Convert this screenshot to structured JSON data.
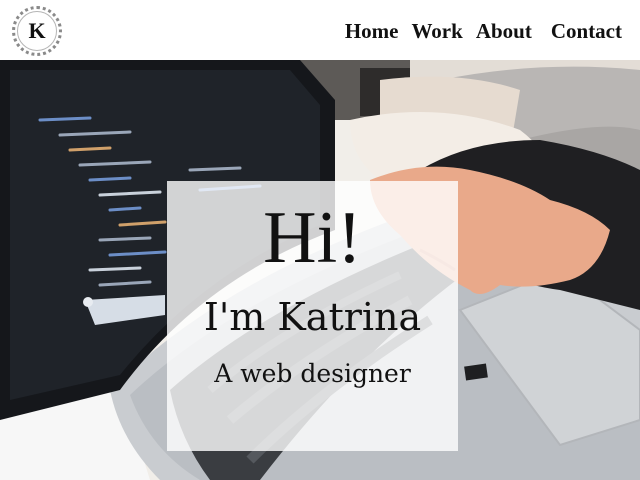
{
  "header": {
    "logo_letter": "K",
    "nav": {
      "home": "Home",
      "work": "Work",
      "about": "About",
      "contact": "Contact"
    }
  },
  "hero": {
    "greeting": "Hi!",
    "name": "I'm Katrina",
    "role": "A web designer"
  }
}
